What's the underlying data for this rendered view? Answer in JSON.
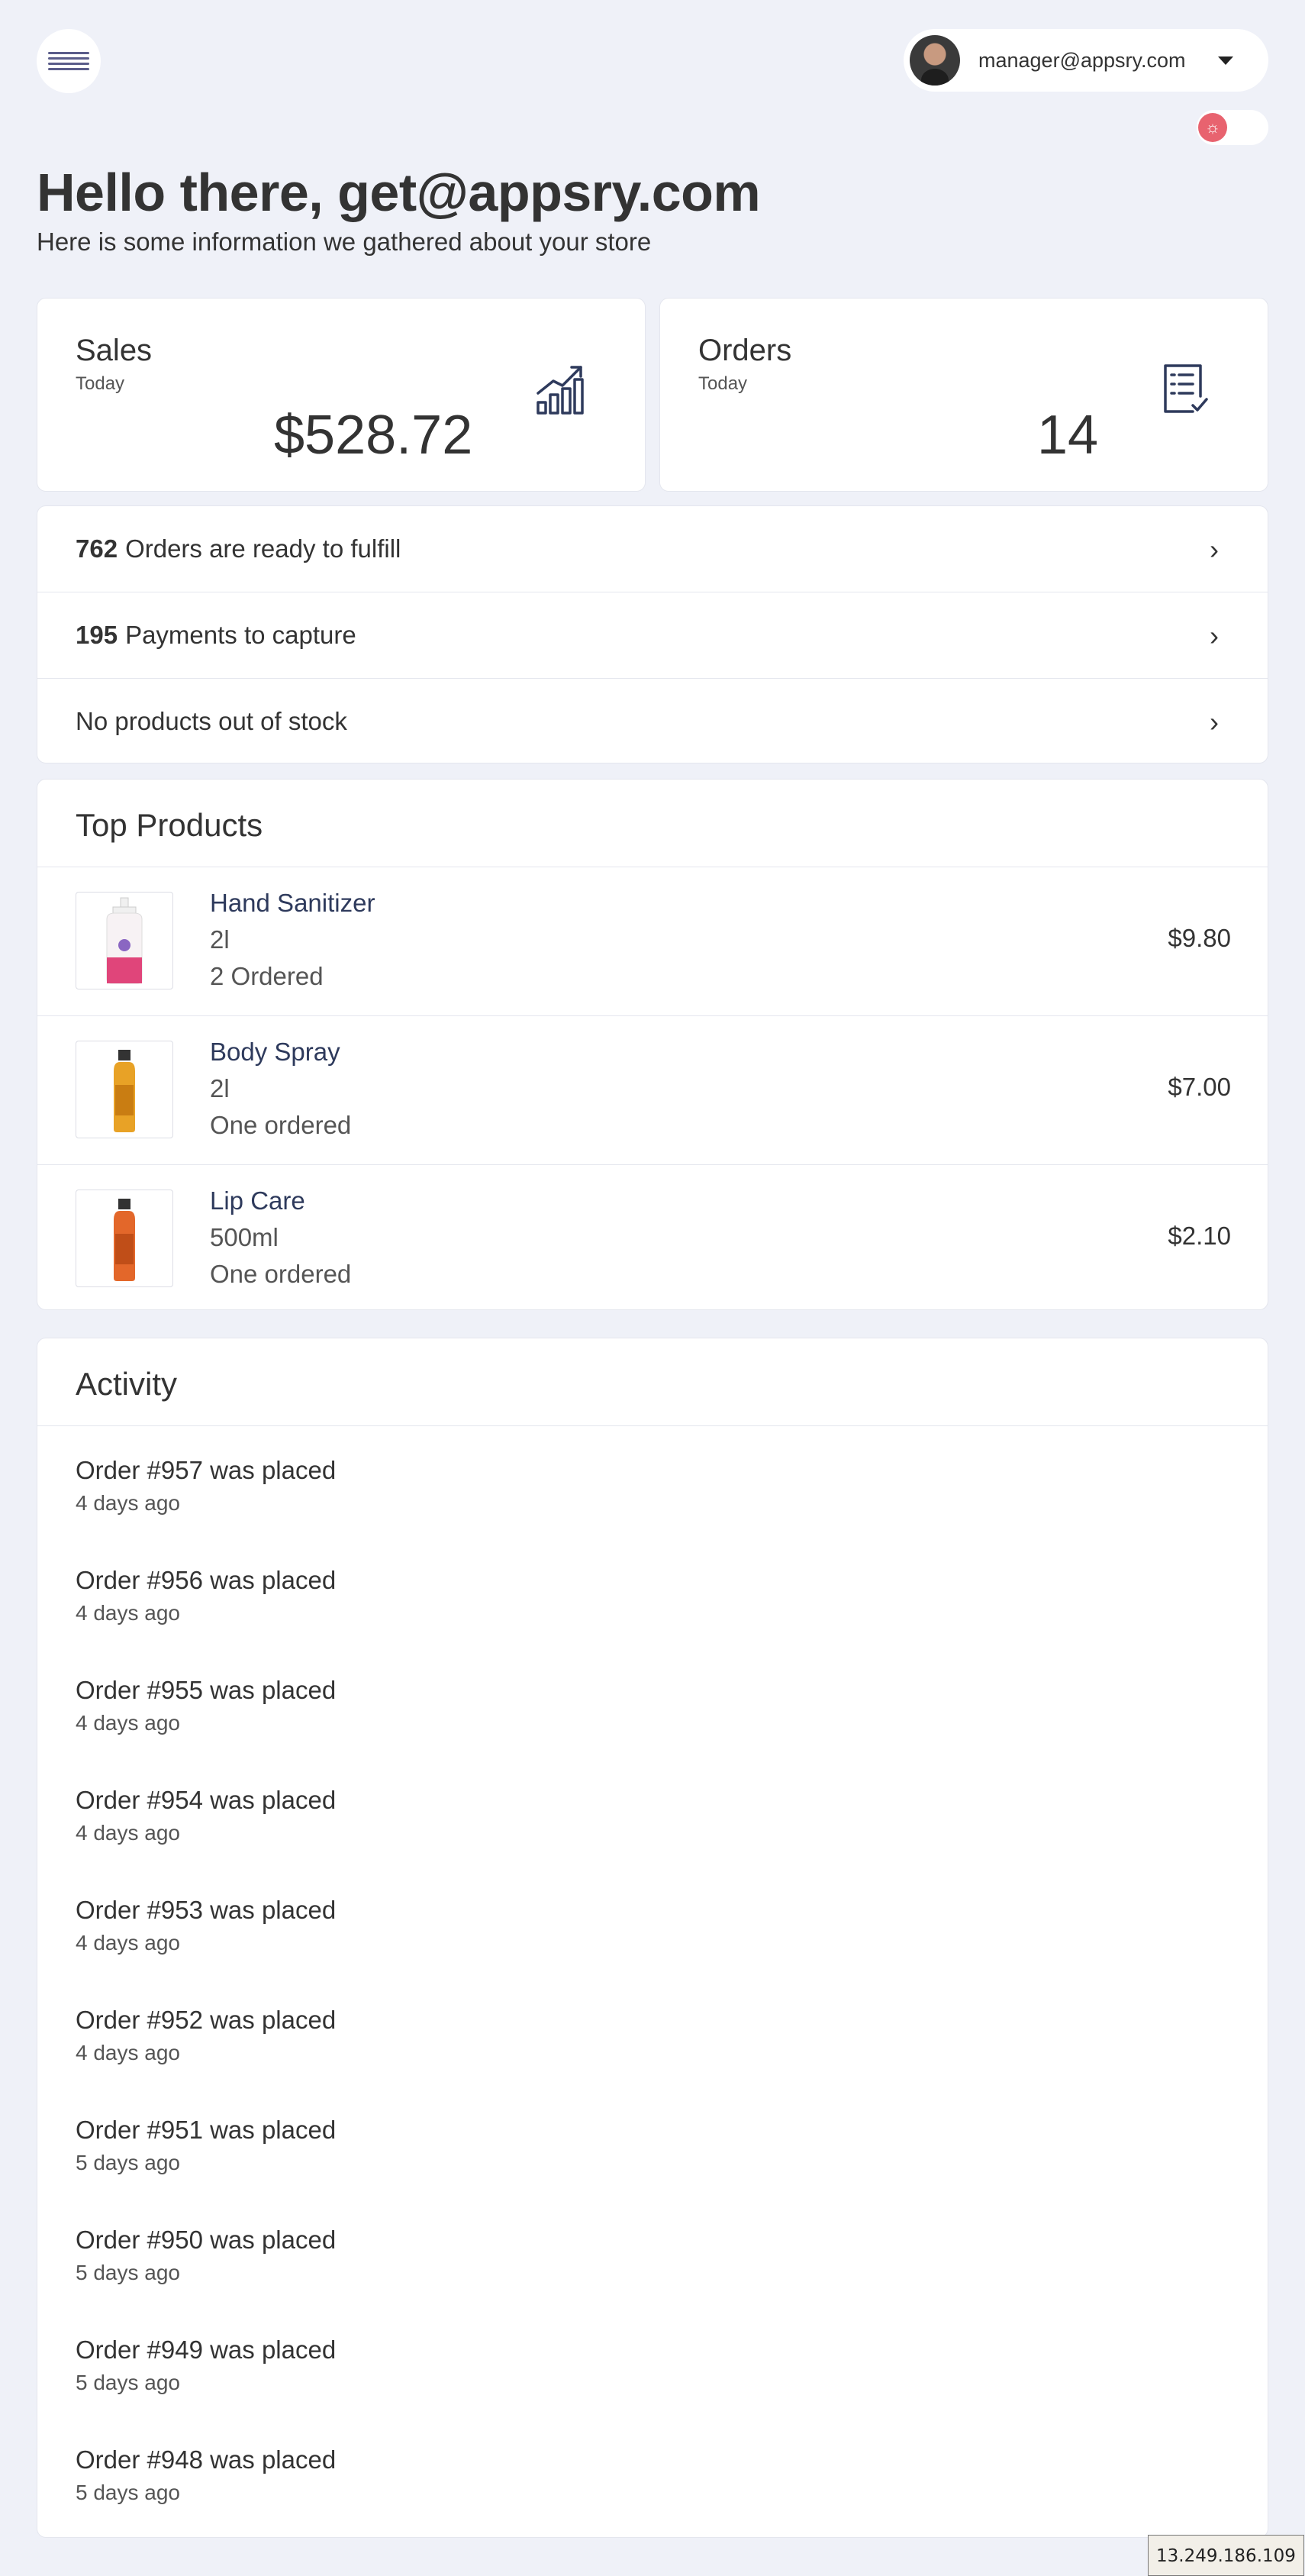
{
  "header": {
    "user_email": "manager@appsry.com"
  },
  "greeting": "Hello there, get@appsry.com",
  "subtitle": "Here is some information we gathered about your store",
  "stats": {
    "sales": {
      "title": "Sales",
      "period": "Today",
      "value": "$528.72",
      "icon": "chart-growth-icon"
    },
    "orders": {
      "title": "Orders",
      "period": "Today",
      "value": "14",
      "icon": "checklist-icon"
    }
  },
  "actions": [
    {
      "count": "762",
      "text": "Orders are ready to fulfill"
    },
    {
      "count": "195",
      "text": "Payments to capture"
    },
    {
      "count": "",
      "text": "No products out of stock"
    }
  ],
  "top_products": {
    "title": "Top Products",
    "items": [
      {
        "name": "Hand Sanitizer",
        "size": "2l",
        "ordered": "2 Ordered",
        "price": "$9.80",
        "color": "#e0457a"
      },
      {
        "name": "Body Spray",
        "size": "2l",
        "ordered": "One ordered",
        "price": "$7.00",
        "color": "#e8a226"
      },
      {
        "name": "Lip Care",
        "size": "500ml",
        "ordered": "One ordered",
        "price": "$2.10",
        "color": "#e3672a"
      }
    ]
  },
  "activity": {
    "title": "Activity",
    "items": [
      {
        "text": "Order #957 was placed",
        "time": "4 days ago"
      },
      {
        "text": "Order #956 was placed",
        "time": "4 days ago"
      },
      {
        "text": "Order #955 was placed",
        "time": "4 days ago"
      },
      {
        "text": "Order #954 was placed",
        "time": "4 days ago"
      },
      {
        "text": "Order #953 was placed",
        "time": "4 days ago"
      },
      {
        "text": "Order #952 was placed",
        "time": "4 days ago"
      },
      {
        "text": "Order #951 was placed",
        "time": "5 days ago"
      },
      {
        "text": "Order #950 was placed",
        "time": "5 days ago"
      },
      {
        "text": "Order #949 was placed",
        "time": "5 days ago"
      },
      {
        "text": "Order #948 was placed",
        "time": "5 days ago"
      }
    ]
  },
  "footer": {
    "ip": "13.249.186.109"
  },
  "colors": {
    "background": "#eff1f8",
    "toggle_accent": "#e8636f",
    "product_link": "#2e3a5c"
  }
}
